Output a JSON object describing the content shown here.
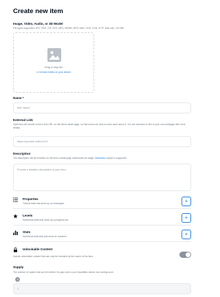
{
  "page": {
    "title": "Create new item"
  },
  "media": {
    "label": "Image, Video, Audio, or 3D Model",
    "hint": "File types supported: JPG, PNG, GIF, SVG, MP4, WEBM, MP3, WAV, OGG, GLB, GLTF. Max size: 100 MB",
    "drop_text": "Drag & drop file",
    "drop_sub_prefix": "or",
    "drop_sub_link": "browse media on your device",
    "icon": "image-icon"
  },
  "name": {
    "label": "Name *",
    "placeholder": "Item Name"
  },
  "external_link": {
    "label": "External Link",
    "help": "OpenSea will include a link to this URL on this item's detail page, so that users can click to learn more about it. You are welcome to link to your own webpage with more details.",
    "placeholder": "https://yoursite.io/item/123"
  },
  "description": {
    "label": "Description",
    "help_prefix": "The description will be included on the item's detail page underneath its image.",
    "help_link": "Markdown",
    "help_suffix": "syntax is supported.",
    "placeholder": "Provide a detailed description of your item."
  },
  "traits": [
    {
      "title": "Properties",
      "desc": "Textual traits that show up as rectangles",
      "icon": "list-icon",
      "add": "+"
    },
    {
      "title": "Levels",
      "desc": "Numerical traits that show as a progress bar",
      "icon": "star-icon",
      "add": "+"
    },
    {
      "title": "Stats",
      "desc": "Numerical traits that just show as numbers",
      "icon": "bar-chart-icon",
      "add": "+"
    }
  ],
  "unlockable": {
    "title": "Unlockable Content",
    "desc": "Include unlockable content that can only be revealed by the owner of the item.",
    "icon": "lock-icon",
    "enabled": false
  },
  "supply": {
    "label": "Supply",
    "help": "The number of copies that can be minted. No gas cost to you! Quantities above one coming soon.",
    "value": "1"
  },
  "colors": {
    "accent": "#2081e2",
    "text": "#04111d",
    "muted": "#707a83",
    "border": "#e5e8eb",
    "toggle_off": "#8a939b"
  }
}
